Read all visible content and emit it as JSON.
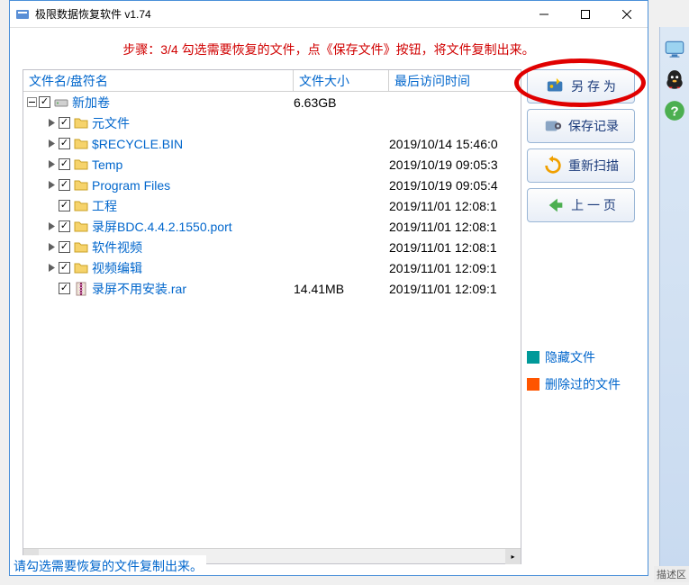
{
  "window": {
    "title": "极限数据恢复软件 v1.74"
  },
  "instruction": "步骤：3/4 勾选需要恢复的文件，点《保存文件》按钮，将文件复制出来。",
  "columns": {
    "name": "文件名/盘符名",
    "size": "文件大小",
    "atime": "最后访问时间"
  },
  "tree": [
    {
      "indent": 0,
      "expander": "minus",
      "checked": true,
      "icon": "drive",
      "name": "新加卷",
      "size": "6.63GB",
      "atime": ""
    },
    {
      "indent": 1,
      "expander": "arrow",
      "checked": true,
      "icon": "folder",
      "name": "元文件",
      "size": "",
      "atime": ""
    },
    {
      "indent": 1,
      "expander": "arrow",
      "checked": true,
      "icon": "folder",
      "name": "$RECYCLE.BIN",
      "size": "",
      "atime": "2019/10/14 15:46:0"
    },
    {
      "indent": 1,
      "expander": "arrow",
      "checked": true,
      "icon": "folder",
      "name": "Temp",
      "size": "",
      "atime": "2019/10/19 09:05:3"
    },
    {
      "indent": 1,
      "expander": "arrow",
      "checked": true,
      "icon": "folder",
      "name": "Program Files",
      "size": "",
      "atime": "2019/10/19 09:05:4"
    },
    {
      "indent": 1,
      "expander": "none",
      "checked": true,
      "icon": "folder",
      "name": "工程",
      "size": "",
      "atime": "2019/11/01 12:08:1"
    },
    {
      "indent": 1,
      "expander": "arrow",
      "checked": true,
      "icon": "folder",
      "name": "录屏BDC.4.4.2.1550.port",
      "size": "",
      "atime": "2019/11/01 12:08:1"
    },
    {
      "indent": 1,
      "expander": "arrow",
      "checked": true,
      "icon": "folder",
      "name": "软件视频",
      "size": "",
      "atime": "2019/11/01 12:08:1"
    },
    {
      "indent": 1,
      "expander": "arrow",
      "checked": true,
      "icon": "folder",
      "name": "视频编辑",
      "size": "",
      "atime": "2019/11/01 12:09:1"
    },
    {
      "indent": 1,
      "expander": "none",
      "checked": true,
      "icon": "rar",
      "name": "录屏不用安装.rar",
      "size": "14.41MB",
      "atime": "2019/11/01 12:09:1"
    }
  ],
  "buttons": {
    "save_as": "另 存 为",
    "save_record": "保存记录",
    "rescan": "重新扫描",
    "prev": "上 一 页"
  },
  "legend": {
    "hidden": "隐藏文件",
    "deleted": "删除过的文件"
  },
  "status": "请勾选需要恢复的文件复制出来。",
  "truncated_label": "描述区"
}
